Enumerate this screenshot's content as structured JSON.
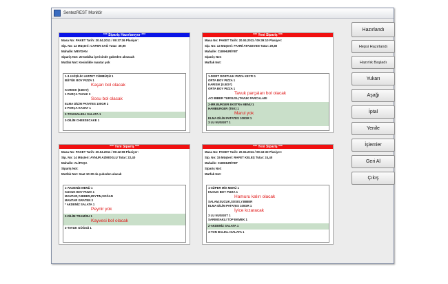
{
  "window": {
    "title": "SentezREST Monitör"
  },
  "orders": [
    {
      "header": "*** Sipariş Hazırlanıyor ***",
      "header_color": "#0a14e6",
      "info": [
        "Masa No: PAKET  Tarih: 20.04.2011 / 09:37:36  Plasiyer:",
        "Sip. No: 12  Müşteri: CAFER SAĞ  Tutar: 39,90",
        "Mahalle: MEYDAN",
        "Sipariş Not: 20 Dakika içerisinde gubeden alınacak",
        "Mutfak Not: Kesinlikle mantar yok"
      ],
      "groups": [
        {
          "lines": [
            {
              "t": "1-3 4 KİŞİLİK LEZZET CÜMBÜŞÜ  1"
            },
            {
              "t": "   BÜYÜK BOY PIZZA  1"
            },
            {
              "t": "Kaşarı bol olacak",
              "red": true
            },
            {
              "t": "      KARISIK (8.BOY)"
            },
            {
              "t": "   1 PARÇA TAVUK  3"
            },
            {
              "t": "Sosu bol olacak",
              "red": true
            },
            {
              "t": "   ELMA DİLİM PATATES 100GR  2"
            },
            {
              "t": "   3 PARÇA KANAT  1"
            }
          ]
        },
        {
          "hl": true,
          "lines": [
            {
              "t": "2-TON BALIKLI SALATA  1"
            }
          ]
        },
        {
          "lines": [
            {
              "t": "3-DİLİM CHEESECAKE  1"
            }
          ]
        }
      ]
    },
    {
      "header": "*** Yeni Sipariş ***",
      "header_color": "#f01010",
      "info": [
        "Masa No: PAKET  Tarih: 20.04.2011 / 09:39:10  Plasiyer:",
        "Sip. No: 13  Müşteri: FAHRİ ATASEVEN  Tutar: 29,80",
        "Mahalle: CUMHURİYET",
        "Sipariş Not:",
        "Mutfak Not:"
      ],
      "groups": [
        {
          "lines": [
            {
              "t": "1-DORT DORTLUK PIZZA KEYFI  1"
            },
            {
              "t": "   ORTA BOY PIZZA  1"
            },
            {
              "t": "      KARISIK (0.BOY)"
            },
            {
              "t": "   ORTA BOY PIZZA  1"
            },
            {
              "t": "Tavuk parçaları bol olacak",
              "red": true
            },
            {
              "t": "      ACI BIBER TURSUSU,TAVUK PARCALARI"
            }
          ]
        },
        {
          "hl": true,
          "lines": [
            {
              "t": "2-MR.BURGER EKSTRA MENÜ  1"
            },
            {
              "t": "   HAMBURGER (TEK)  1"
            },
            {
              "t": "Marul yok",
              "red": true
            },
            {
              "t": "   ELMA DİLİM PATATES 100GR  1"
            },
            {
              "t": "   3 LU NUGGET  1"
            }
          ]
        }
      ]
    },
    {
      "header": "*** Yeni Sipariş ***",
      "header_color": "#f01010",
      "info": [
        "Masa No: PAKET  Tarih: 20.04.2011 / 09:42:08  Plasiyer:",
        "Sip. No: 14  Müşteri: AYNUR AZMIOGLU  Tutar: 22,40",
        "Mahalle: ALİPAŞA",
        "Sipariş Not:",
        "Mutfak Not: Saat 10:30  da şubeden alacak"
      ],
      "groups": [
        {
          "lines": [
            {
              "t": "1-AKDENİZ MENÜ  1"
            },
            {
              "t": "   KUCUK BOY PIZZA  1"
            },
            {
              "t": "      MANTAR,Y.BIBER,ZEYTIN,SOĞAN"
            },
            {
              "t": "   MANTAR GRATEN  3"
            },
            {
              "t": "   * AKDENİZ SALATA  1"
            },
            {
              "t": "Peynir yok",
              "red": true
            }
          ]
        },
        {
          "hl": true,
          "lines": [
            {
              "t": "2-DİLİM TRAMİSU  1"
            },
            {
              "t": "Kayvesi bol olacak",
              "red": true
            }
          ]
        },
        {
          "lines": [
            {
              "t": "3-TAVUK GÖĞSÜ  1"
            }
          ]
        }
      ]
    },
    {
      "header": "*** Yeni Sipariş ***",
      "header_color": "#f01010",
      "info": [
        "Masa No: PAKET  Tarih: 20.04.2011 / 09:43:33  Plasiyer:",
        "Sip. No: 15  Müşteri: RAFET KELEŞ  Tutar: 24,40",
        "Mahalle: CUMHURİYET",
        "Sipariş Not:",
        "Mutfak Not:"
      ],
      "groups": [
        {
          "lines": [
            {
              "t": "1-SÜPER MİX MENÜ  1"
            },
            {
              "t": "   KUCUK BOY PIZZA  1"
            },
            {
              "t": "Hamuru kalın olacak",
              "red": true
            },
            {
              "t": "      SALAM,SUCUK,SOSIS,Y.BIBER"
            },
            {
              "t": "   ELMA DİLİM PATATES 100GR  1"
            },
            {
              "t": "İyice kızaracak",
              "red": true
            },
            {
              "t": "   3 LU NUGGET  1"
            },
            {
              "t": "   SARIMSAKLI TOP EKMEK  1"
            }
          ]
        },
        {
          "hl": true,
          "lines": [
            {
              "t": "2-AKDENİZ SALATA  1"
            }
          ]
        },
        {
          "lines": [
            {
              "t": "3-TON BALIKLI SALATA  1"
            }
          ]
        }
      ]
    }
  ],
  "toolbar": {
    "hazirlandi": "Hazırlandı",
    "hepsi_hazirlandi": "Hepsi Hazırlandı",
    "hazirlik_basladi": "Hazırlık Başladı",
    "yukari": "Yukarı",
    "asagi": "Aşağı",
    "iptal": "İptal",
    "yenile": "Yenile",
    "islemler": "İşlemler",
    "geri_al": "Geri Al",
    "cikis": "Çıkış"
  }
}
